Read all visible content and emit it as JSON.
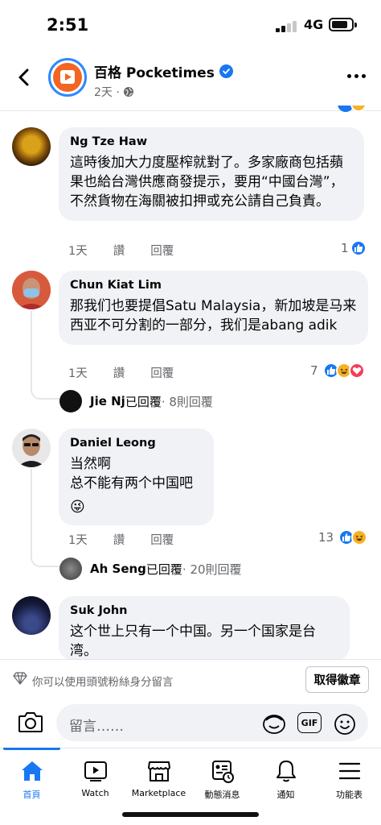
{
  "status_bar": {
    "time": "2:51",
    "network": "4G"
  },
  "header": {
    "page_name": "百格 Pocketimes",
    "meta": "2天 ·"
  },
  "comments": [
    {
      "name": "Ng Tze Haw",
      "text": "這時後加大力度壓榨就對了。多家廠商包括蘋果也給台灣供應商發提示，要用“中國台灣”，不然貨物在海關被扣押或充公請自己負責。",
      "time": "1天",
      "like_label": "讚",
      "reply_label": "回覆",
      "reaction_count": "1"
    },
    {
      "name": "Chun Kiat Lim",
      "text": "那我们也要提倡Satu Malaysia，新加坡是马来西亚不可分割的一部分，我们是abang adik",
      "time": "1天",
      "like_label": "讚",
      "reply_label": "回覆",
      "reaction_count": "7",
      "reply_preview": {
        "name": "Jie Nj",
        "text": "已回覆",
        "count": " · 8則回覆"
      }
    },
    {
      "name": "Daniel Leong",
      "text_line1": "当然啊",
      "text_line2": "总不能有两个中国吧",
      "emoji": "😜",
      "time": "1天",
      "like_label": "讚",
      "reply_label": "回覆",
      "reaction_count": "13",
      "reply_preview": {
        "name": "Ah Seng",
        "text": "已回覆",
        "count": " · 20則回覆"
      }
    },
    {
      "name": "Suk John",
      "text": "这个世上只有一个中国。另一个国家是台湾。"
    }
  ],
  "anon_bar": {
    "text": "你可以使用頭號粉絲身分留言",
    "button": "取得徽章"
  },
  "composer": {
    "placeholder": "留言……",
    "gif_label": "GIF"
  },
  "nav": [
    {
      "label": "首頁",
      "icon": "home-icon",
      "active": true
    },
    {
      "label": "Watch",
      "icon": "watch-icon"
    },
    {
      "label": "Marketplace",
      "icon": "marketplace-icon"
    },
    {
      "label": "動態消息",
      "icon": "feeds-icon"
    },
    {
      "label": "通知",
      "icon": "bell-icon"
    },
    {
      "label": "功能表",
      "icon": "menu-icon"
    }
  ],
  "colors": {
    "accent": "#1877f2",
    "bubble": "#f0f2f5",
    "muted": "#65676b"
  }
}
